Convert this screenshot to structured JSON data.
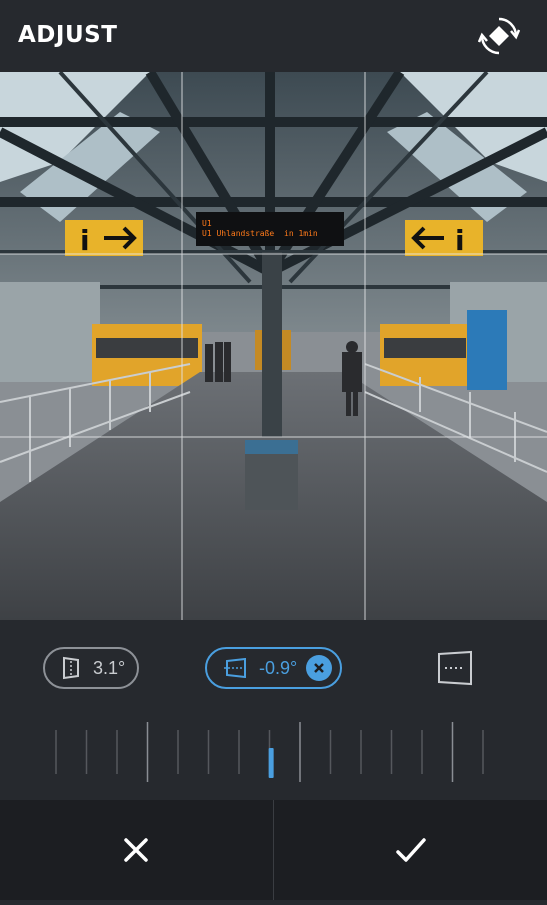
{
  "header": {
    "title": "ADJUST",
    "rotate_icon": "rotate-icon"
  },
  "photo": {
    "sign_left_symbol": "i",
    "sign_right_symbol": "i",
    "departure_board_line1": "U1",
    "departure_board_line2": "U1 Uhlandstraße",
    "departure_board_time": "in 1min"
  },
  "controls": {
    "vertical_value": "3.1°",
    "horizontal_value": "-0.9°",
    "perspective_icon": "perspective-icon"
  },
  "ruler": {
    "level": -0.9
  },
  "footer": {
    "cancel_icon": "close-icon",
    "confirm_icon": "check-icon"
  },
  "colors": {
    "accent": "#4a9fe0",
    "background": "#26292e",
    "footer": "#1c1e22"
  }
}
